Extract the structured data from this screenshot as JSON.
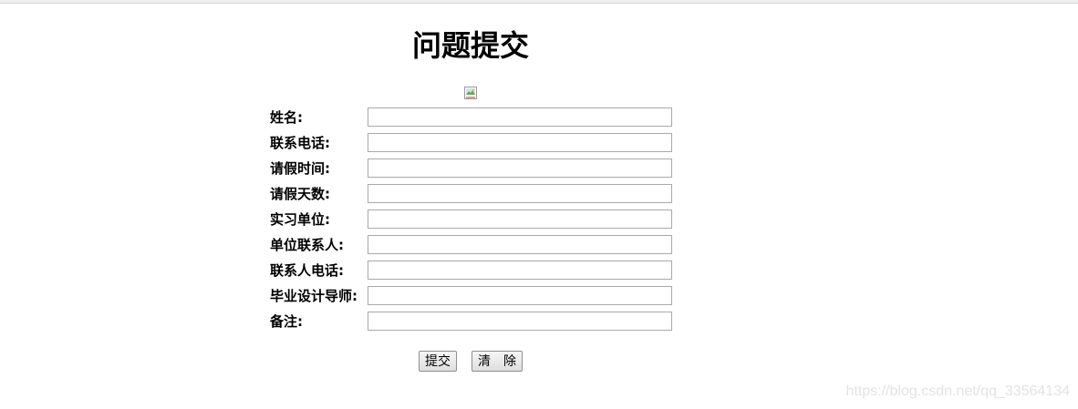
{
  "page": {
    "title": "问题提交"
  },
  "form": {
    "fields": [
      {
        "label": "姓名:",
        "value": ""
      },
      {
        "label": "联系电话:",
        "value": ""
      },
      {
        "label": "请假时间:",
        "value": ""
      },
      {
        "label": "请假天数:",
        "value": ""
      },
      {
        "label": "实习单位:",
        "value": ""
      },
      {
        "label": "单位联系人:",
        "value": ""
      },
      {
        "label": "联系人电话:",
        "value": ""
      },
      {
        "label": "毕业设计导师:",
        "value": ""
      },
      {
        "label": "备注:",
        "value": ""
      }
    ],
    "submit_label": "提交",
    "clear_label": "清　除"
  },
  "image": {
    "icon": "broken-image-icon"
  },
  "watermark": "https://blog.csdn.net/qq_33564134"
}
